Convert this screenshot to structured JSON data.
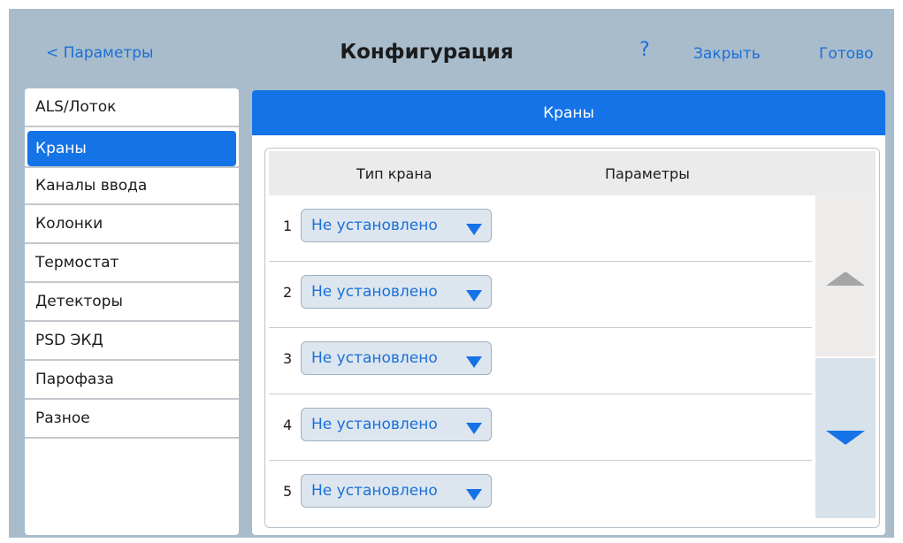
{
  "header": {
    "back_label": "< Параметры",
    "title": "Конфигурация",
    "help_label": "?",
    "close_label": "Закрыть",
    "done_label": "Готово"
  },
  "sidebar": {
    "items": [
      {
        "label": "ALS/Лоток",
        "selected": false
      },
      {
        "label": "Краны",
        "selected": true
      },
      {
        "label": "Каналы ввода",
        "selected": false
      },
      {
        "label": "Колонки",
        "selected": false
      },
      {
        "label": "Термостат",
        "selected": false
      },
      {
        "label": "Детекторы",
        "selected": false
      },
      {
        "label": "PSD ЭКД",
        "selected": false
      },
      {
        "label": "Парофаза",
        "selected": false
      },
      {
        "label": "Разное",
        "selected": false
      }
    ]
  },
  "panel": {
    "title": "Краны",
    "columns": {
      "type": "Тип крана",
      "params": "Параметры"
    },
    "rows": [
      {
        "num": "1",
        "value": "Не установлено"
      },
      {
        "num": "2",
        "value": "Не установлено"
      },
      {
        "num": "3",
        "value": "Не установлено"
      },
      {
        "num": "4",
        "value": "Не установлено"
      },
      {
        "num": "5",
        "value": "Не установлено"
      }
    ]
  },
  "colors": {
    "background": "#a9bccb",
    "accent": "#1473e6",
    "link": "#1a6fd8",
    "select_bg": "#dde6ee"
  },
  "icons": {
    "dropdown": "chevron-down-icon",
    "scroll_up": "triangle-up-icon",
    "scroll_down": "triangle-down-icon"
  }
}
